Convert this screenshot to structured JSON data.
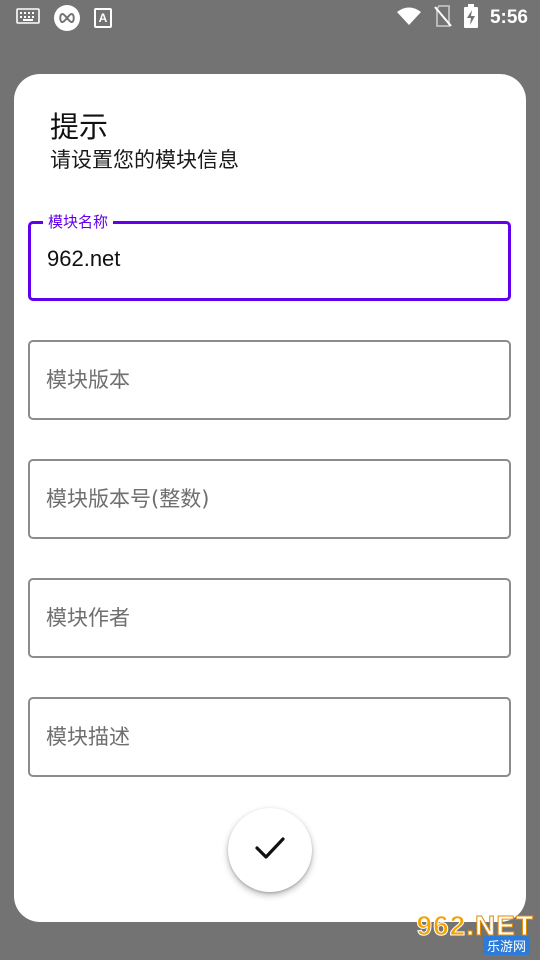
{
  "status_bar": {
    "time": "5:56",
    "icons": [
      "keyboard-icon",
      "infinity-icon",
      "a-box-icon",
      "wifi-icon",
      "no-sim-icon",
      "battery-charging-icon"
    ],
    "a_icon_letter": "A"
  },
  "dialog": {
    "title": "提示",
    "message": "请设置您的模块信息",
    "fields": [
      {
        "label": "模块名称",
        "value": "962.net",
        "focused": true
      },
      {
        "placeholder": "模块版本"
      },
      {
        "placeholder": "模块版本号(整数)"
      },
      {
        "placeholder": "模块作者"
      },
      {
        "placeholder": "模块描述"
      }
    ],
    "confirm_icon": "check-icon",
    "accent_color": "#6200ee"
  },
  "watermark": {
    "number": "962",
    "suffix": ".NET",
    "subtitle": "乐游网"
  }
}
